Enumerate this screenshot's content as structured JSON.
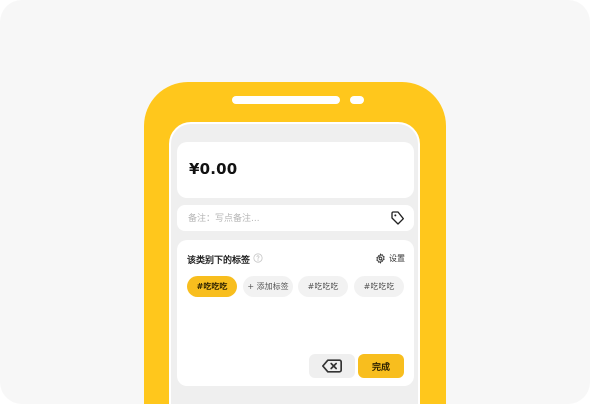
{
  "amount": {
    "value": "¥0.00"
  },
  "note": {
    "placeholder": "备注：写点备注..."
  },
  "tags_panel": {
    "title": "该类别下的标签",
    "settings_label": "设置",
    "chips": [
      {
        "label": "#吃吃吃",
        "selected": true
      },
      {
        "label": "+ 添加标签",
        "selected": false
      },
      {
        "label": "#吃吃吃",
        "selected": false
      },
      {
        "label": "#吃吃吃",
        "selected": false
      }
    ]
  },
  "keypad": {
    "done_label": "完成"
  },
  "colors": {
    "accent": "#ffc71c",
    "button": "#f8be1e",
    "background": "#f7f7f7"
  },
  "icons": {
    "note": "tag-icon",
    "help": "help-circle-icon",
    "settings": "gear-icon",
    "delete": "backspace-icon"
  }
}
